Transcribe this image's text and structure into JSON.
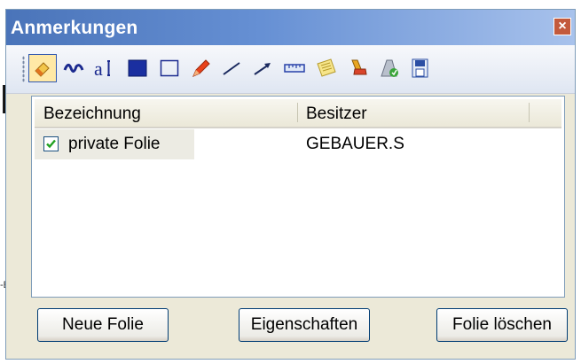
{
  "window": {
    "title": "Anmerkungen",
    "close_glyph": "×"
  },
  "toolbar": {
    "tools": [
      {
        "icon": "eraser-icon"
      },
      {
        "icon": "freehand-icon"
      },
      {
        "icon": "text-icon",
        "glyph": "a"
      },
      {
        "icon": "filled-rectangle-icon"
      },
      {
        "icon": "rectangle-icon"
      },
      {
        "icon": "highlighter-icon"
      },
      {
        "icon": "line-icon"
      },
      {
        "icon": "arrow-icon"
      },
      {
        "icon": "measure-icon"
      },
      {
        "icon": "sticky-note-icon"
      },
      {
        "icon": "stamp-icon"
      },
      {
        "icon": "signature-icon"
      },
      {
        "icon": "save-icon"
      }
    ]
  },
  "list": {
    "columns": [
      "Bezeichnung",
      "Besitzer"
    ],
    "rows": [
      {
        "checked": true,
        "name": "private Folie",
        "owner": "GEBAUER.S"
      }
    ]
  },
  "buttons": {
    "new": "Neue Folie",
    "properties": "Eigenschaften",
    "delete": "Folie löschen"
  },
  "colors": {
    "titlebar": "#4a74b9",
    "accent": "#0a246a",
    "check": "#21a121"
  }
}
